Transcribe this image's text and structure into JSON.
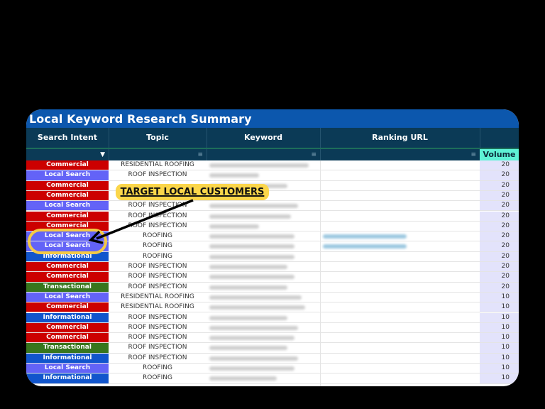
{
  "title": "Local Keyword Research Summary",
  "columns": [
    {
      "label": "Search Intent",
      "filter": "filter-active-icon"
    },
    {
      "label": "Topic",
      "filter": "filter-icon"
    },
    {
      "label": "Keyword",
      "filter": "filter-icon"
    },
    {
      "label": "Ranking URL",
      "filter": "filter-icon"
    },
    {
      "label": "Volume"
    }
  ],
  "colors": {
    "Commercial": "#cc0000",
    "Local Search": "#6363f7",
    "Informational": "#1155cc",
    "Transactional": "#38761d",
    "title_bar": "#0c57ad",
    "header": "#0b3a56",
    "volume_header": "#5ef2d6",
    "callout": "#fbd64a"
  },
  "rows": [
    {
      "intent": "Commercial",
      "topic": "RESIDENTIAL ROOFING",
      "keyword": "[blurred]",
      "url": "",
      "volume": "20"
    },
    {
      "intent": "Local Search",
      "topic": "ROOF INSPECTION",
      "keyword": "[blurred]",
      "url": "",
      "volume": "20"
    },
    {
      "intent": "Commercial",
      "topic": "",
      "keyword": "[blurred]",
      "url": "",
      "volume": "20"
    },
    {
      "intent": "Commercial",
      "topic": "",
      "keyword": "",
      "url": "",
      "volume": "20"
    },
    {
      "intent": "Local Search",
      "topic": "ROOF INSPECTION",
      "keyword": "[blurred]",
      "url": "",
      "volume": "20"
    },
    {
      "intent": "Commercial",
      "topic": "ROOF INSPECTION",
      "keyword": "[blurred]",
      "url": "",
      "volume": "20"
    },
    {
      "intent": "Commercial",
      "topic": "ROOF INSPECTION",
      "keyword": "[blurred]",
      "url": "",
      "volume": "20"
    },
    {
      "intent": "Local Search",
      "topic": "ROOFING",
      "keyword": "[blurred]",
      "url": "[blurred link]",
      "volume": "20"
    },
    {
      "intent": "Local Search",
      "topic": "ROOFING",
      "keyword": "[blurred]",
      "url": "[blurred link]",
      "volume": "20"
    },
    {
      "intent": "Informational",
      "topic": "ROOFING",
      "keyword": "[blurred]",
      "url": "",
      "volume": "20"
    },
    {
      "intent": "Commercial",
      "topic": "ROOF INSPECTION",
      "keyword": "[blurred]",
      "url": "",
      "volume": "20"
    },
    {
      "intent": "Commercial",
      "topic": "ROOF INSPECTION",
      "keyword": "[blurred]",
      "url": "",
      "volume": "20"
    },
    {
      "intent": "Transactional",
      "topic": "ROOF INSPECTION",
      "keyword": "[blurred]",
      "url": "",
      "volume": "20"
    },
    {
      "intent": "Local Search",
      "topic": "RESIDENTIAL ROOFING",
      "keyword": "[blurred]",
      "url": "",
      "volume": "10"
    },
    {
      "intent": "Commercial",
      "topic": "RESIDENTIAL ROOFING",
      "keyword": "[blurred]",
      "url": "",
      "volume": "10"
    },
    {
      "intent": "Informational",
      "topic": "ROOF INSPECTION",
      "keyword": "[blurred]",
      "url": "",
      "volume": "10"
    },
    {
      "intent": "Commercial",
      "topic": "ROOF INSPECTION",
      "keyword": "[blurred]",
      "url": "",
      "volume": "10"
    },
    {
      "intent": "Commercial",
      "topic": "ROOF INSPECTION",
      "keyword": "[blurred]",
      "url": "",
      "volume": "10"
    },
    {
      "intent": "Transactional",
      "topic": "ROOF INSPECTION",
      "keyword": "[blurred]",
      "url": "",
      "volume": "10"
    },
    {
      "intent": "Informational",
      "topic": "ROOF INSPECTION",
      "keyword": "[blurred]",
      "url": "",
      "volume": "10"
    },
    {
      "intent": "Local Search",
      "topic": "ROOFING",
      "keyword": "[blurred]",
      "url": "",
      "volume": "10"
    },
    {
      "intent": "Informational",
      "topic": "ROOFING",
      "keyword": "[blurred]",
      "url": "",
      "volume": "10"
    }
  ],
  "annotation": {
    "callout_text": "TARGET LOCAL CUSTOMERS",
    "highlighted_rows": [
      8,
      9
    ]
  }
}
